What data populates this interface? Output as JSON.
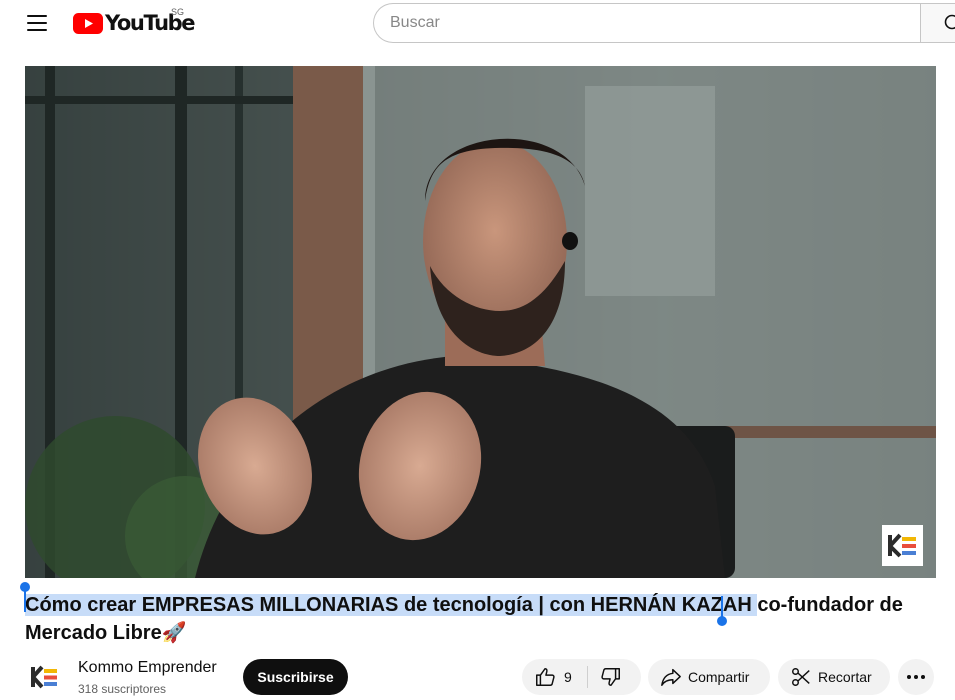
{
  "header": {
    "logo_text": "YouTube",
    "country_code": "SG",
    "search_placeholder": "Buscar"
  },
  "video": {
    "title_selected": "Cómo crear EMPRESAS MILLONARIAS de tecnología | con HERNÁN KAZAH ",
    "title_rest": "co-fundador de Mercado Libre🚀",
    "watermark_icon": "kommo-logo-icon"
  },
  "channel": {
    "name": "Kommo Emprender",
    "subscribers": "318 suscriptores",
    "subscribe_label": "Suscribirse"
  },
  "actions": {
    "like_count": "9",
    "share_label": "Compartir",
    "clip_label": "Recortar"
  },
  "colors": {
    "brand_red": "#ff0000",
    "selection": "#c7dcf8",
    "handle_blue": "#1a73e8",
    "pill_bg": "#f2f2f2"
  }
}
